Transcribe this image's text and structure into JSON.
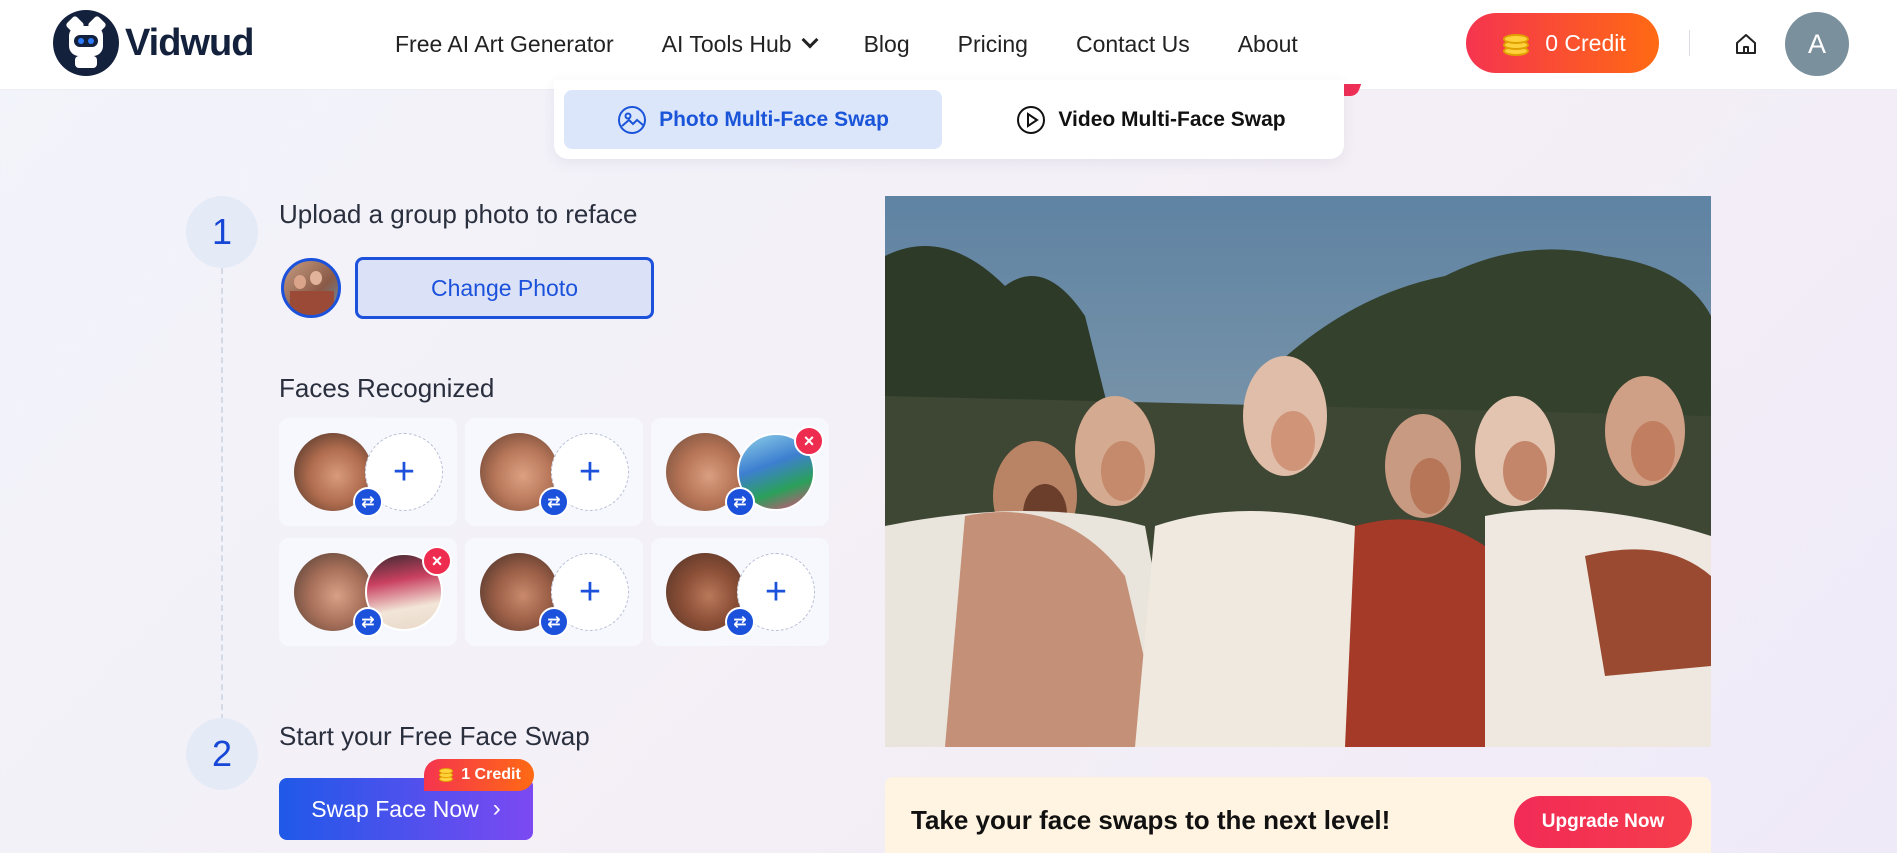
{
  "brand": {
    "name": "Vidwud"
  },
  "nav": {
    "items": [
      {
        "label": "Free AI Art Generator"
      },
      {
        "label": "AI Tools Hub"
      },
      {
        "label": "Blog"
      },
      {
        "label": "Pricing"
      },
      {
        "label": "Contact Us"
      },
      {
        "label": "About"
      }
    ]
  },
  "header": {
    "credit_label": "0 Credit",
    "avatar_initial": "A"
  },
  "tabs": {
    "photo": "Photo Multi-Face Swap",
    "video": "Video Multi-Face Swap",
    "active": "photo"
  },
  "step1": {
    "number": "1",
    "title": "Upload a group photo to reface",
    "change_button": "Change Photo"
  },
  "faces": {
    "title": "Faces Recognized",
    "items": [
      {
        "target": "empty",
        "plus": "+"
      },
      {
        "target": "empty",
        "plus": "+"
      },
      {
        "target": "filled",
        "remove": "×"
      },
      {
        "target": "filled",
        "remove": "×"
      },
      {
        "target": "empty",
        "plus": "+"
      },
      {
        "target": "empty",
        "plus": "+"
      }
    ],
    "swap_symbol": "⇄"
  },
  "step2": {
    "number": "2",
    "title": "Start your Free Face Swap",
    "button": "Swap Face Now",
    "button_arrow": "›",
    "cost": "1 Credit"
  },
  "upgrade": {
    "text": "Take your face swaps to the next level!",
    "button": "Upgrade Now"
  },
  "colors": {
    "accent": "#1b51db",
    "credit_gradient_start": "#f5344f",
    "credit_gradient_end": "#ff6a13"
  }
}
